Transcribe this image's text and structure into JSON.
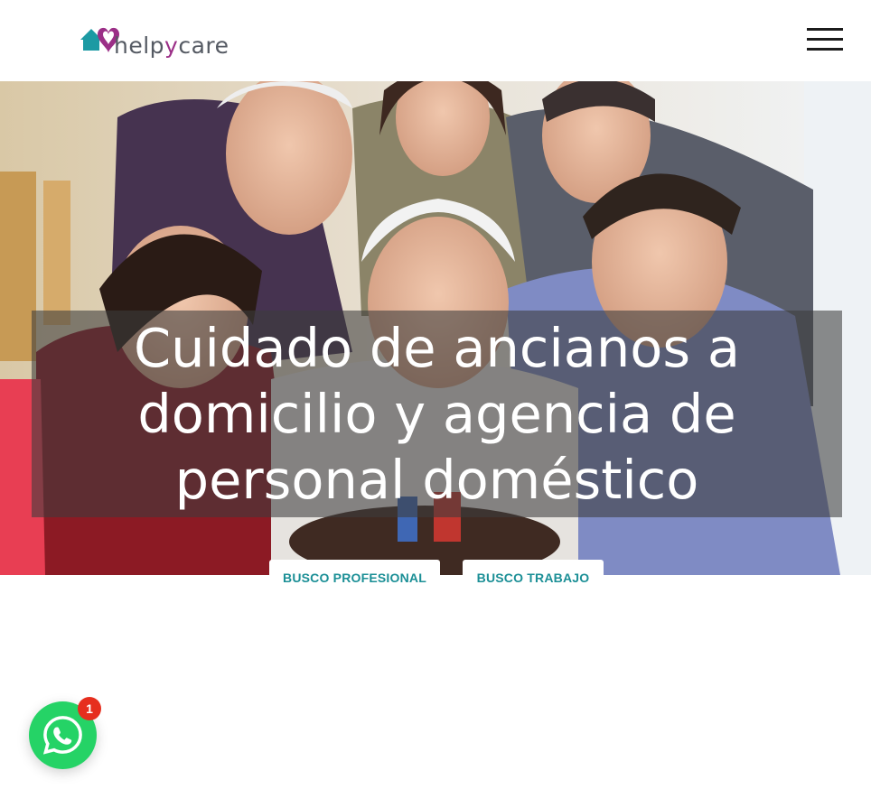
{
  "header": {
    "logo_text_pre": "help",
    "logo_text_y": "y",
    "logo_text_post": "care"
  },
  "hero": {
    "title": "Cuidado de ancianos a domicilio y agencia de personal doméstico"
  },
  "cta": {
    "professional_label": "BUSCO PROFESIONAL",
    "job_label": "BUSCO TRABAJO"
  },
  "whatsapp": {
    "badge_count": "1"
  },
  "colors": {
    "accent_teal": "#1b8f96",
    "logo_purple": "#9b2f87",
    "whatsapp_green": "#25d366",
    "badge_red": "#e62e1e"
  },
  "icons": {
    "logo": "house-heart-logo-icon",
    "menu": "hamburger-menu-icon",
    "chat": "whatsapp-icon"
  }
}
